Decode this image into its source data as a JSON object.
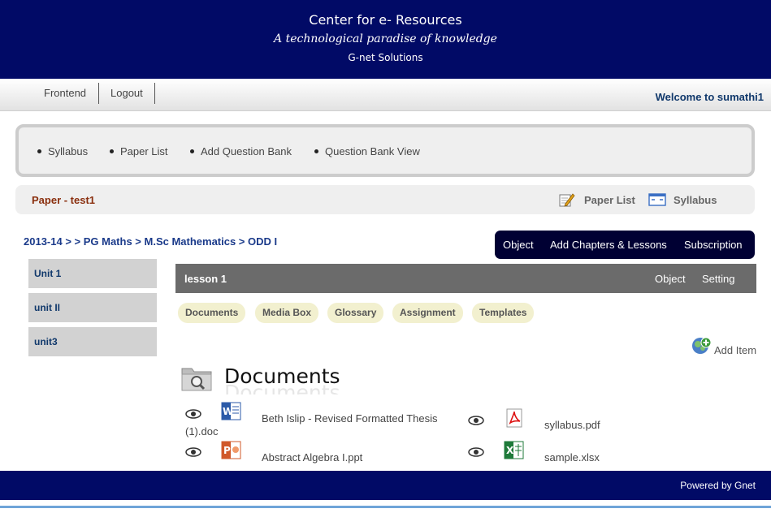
{
  "header": {
    "title": "Center for e- Resources",
    "tagline": "A technological paradise of knowledge",
    "company": "G-net Solutions"
  },
  "topnav": {
    "items": [
      "Frontend",
      "Logout"
    ],
    "welcome": "Welcome to sumathi1"
  },
  "menu": {
    "items": [
      "Syllabus",
      "Paper List",
      "Add Question Bank",
      "Question Bank View"
    ]
  },
  "paper": {
    "title": "Paper - test1",
    "links": [
      "Paper List",
      "Syllabus"
    ]
  },
  "breadcrumb": "2013-14 > > PG Maths > M.Sc Mathematics > ODD I",
  "dark_tabs": [
    "Object",
    "Add Chapters & Lessons",
    "Subscription"
  ],
  "units": [
    "Unit 1",
    "unit II",
    "unit3"
  ],
  "lesson": {
    "title": "lesson 1",
    "links": [
      "Object",
      "Setting"
    ]
  },
  "pills": [
    "Documents",
    "Media Box",
    "Glossary",
    "Assignment",
    "Templates"
  ],
  "add_item": "Add Item",
  "documents": {
    "heading": "Documents",
    "files": [
      {
        "name_line1": "Beth Islip - Revised Formatted Thesis",
        "name_line2": "(1).doc",
        "icon": "word-doc-icon"
      },
      {
        "name_line1": "syllabus.pdf",
        "icon": "pdf-icon"
      },
      {
        "name_line1": "Abstract Algebra I.ppt",
        "icon": "powerpoint-icon"
      },
      {
        "name_line1": "sample.xlsx",
        "icon": "excel-icon"
      }
    ]
  },
  "footer": {
    "powered": "Powered by Gnet"
  },
  "colors": {
    "header_bg": "#010a66",
    "breadcrumb": "#1a3a8a",
    "paper_title": "#8a2f0e",
    "pill_bg": "#f2f0cf",
    "lesson_bar": "#6b6b6b"
  }
}
